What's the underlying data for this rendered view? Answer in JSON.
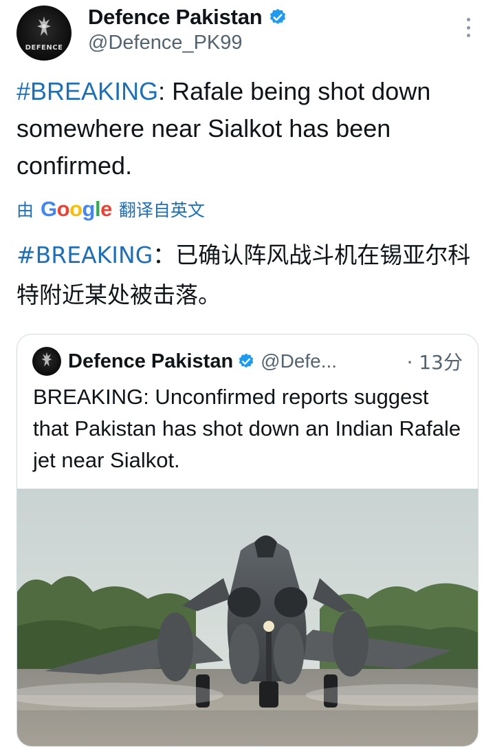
{
  "tweet": {
    "author": {
      "display_name": "Defence Pakistan",
      "handle": "@Defence_PK99",
      "avatar_text": "DEFENCE",
      "verified_icon": "verified-badge-icon"
    },
    "more_icon": "more-options-icon",
    "text": {
      "hashtag": "#BREAKING",
      "body": ": Rafale being shot down somewhere near Sialkot has been confirmed."
    },
    "translation": {
      "prefix": "由",
      "provider": "Google",
      "suffix": "翻译自英文",
      "hashtag": "#BREAKING",
      "body": "：已确认阵风战斗机在锡亚尔科特附近某处被击落。"
    },
    "quoted": {
      "display_name": "Defence Pakistan",
      "handle": "@Defe...",
      "time": "· 13分",
      "text": "BREAKING: Unconfirmed reports suggest that Pakistan has shot down an Indian Rafale jet near Sialkot.",
      "media_icon": "fighter-jet-photo"
    }
  },
  "colors": {
    "hashtag": "#1d6fb8",
    "secondary_text": "#536471",
    "verified": "#1d9bf0",
    "border": "#cfd9de"
  }
}
